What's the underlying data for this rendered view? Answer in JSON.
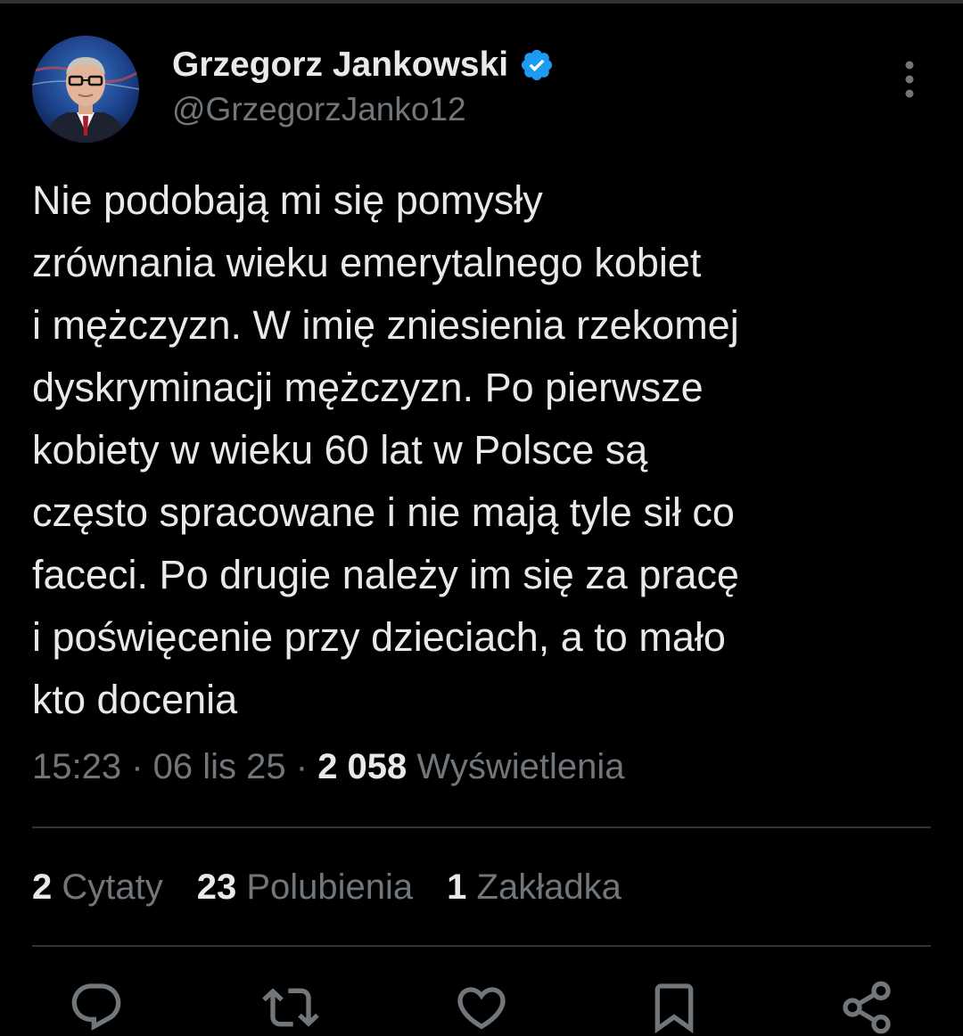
{
  "author": {
    "name": "Grzegorz Jankowski",
    "handle": "@GrzegorzJanko12",
    "verified_color": "#1d9bf0"
  },
  "tweet": {
    "lines": [
      "Nie podobają mi się pomysły",
      "zrównania wieku emerytalnego kobiet",
      "i mężczyzn. W imię zniesienia rzekomej",
      "dyskryminacji mężczyzn. Po pierwsze",
      "kobiety w wieku 60 lat w Polsce są",
      "często spracowane i nie mają tyle sił co",
      "faceci. Po drugie należy im się za pracę",
      "i poświęcenie przy dzieciach, a to mało",
      "kto docenia"
    ]
  },
  "meta": {
    "time": "15:23",
    "separator": " · ",
    "date": "06 lis 25",
    "views_count": "2 058",
    "views_label": " Wyświetlenia"
  },
  "stats": {
    "quotes": {
      "count": "2",
      "label": " Cytaty"
    },
    "likes": {
      "count": "23",
      "label": " Polubienia"
    },
    "bookmarks": {
      "count": "1",
      "label": " Zakładka"
    }
  },
  "icons": {
    "more": "more-vertical-icon",
    "reply": "reply-icon",
    "retweet": "retweet-icon",
    "like": "heart-icon",
    "bookmark": "bookmark-icon",
    "share": "share-icon"
  },
  "colors": {
    "background": "#000000",
    "text": "#e7e9ea",
    "secondary": "#71767b",
    "divider": "#2f3336",
    "accent": "#1d9bf0"
  }
}
